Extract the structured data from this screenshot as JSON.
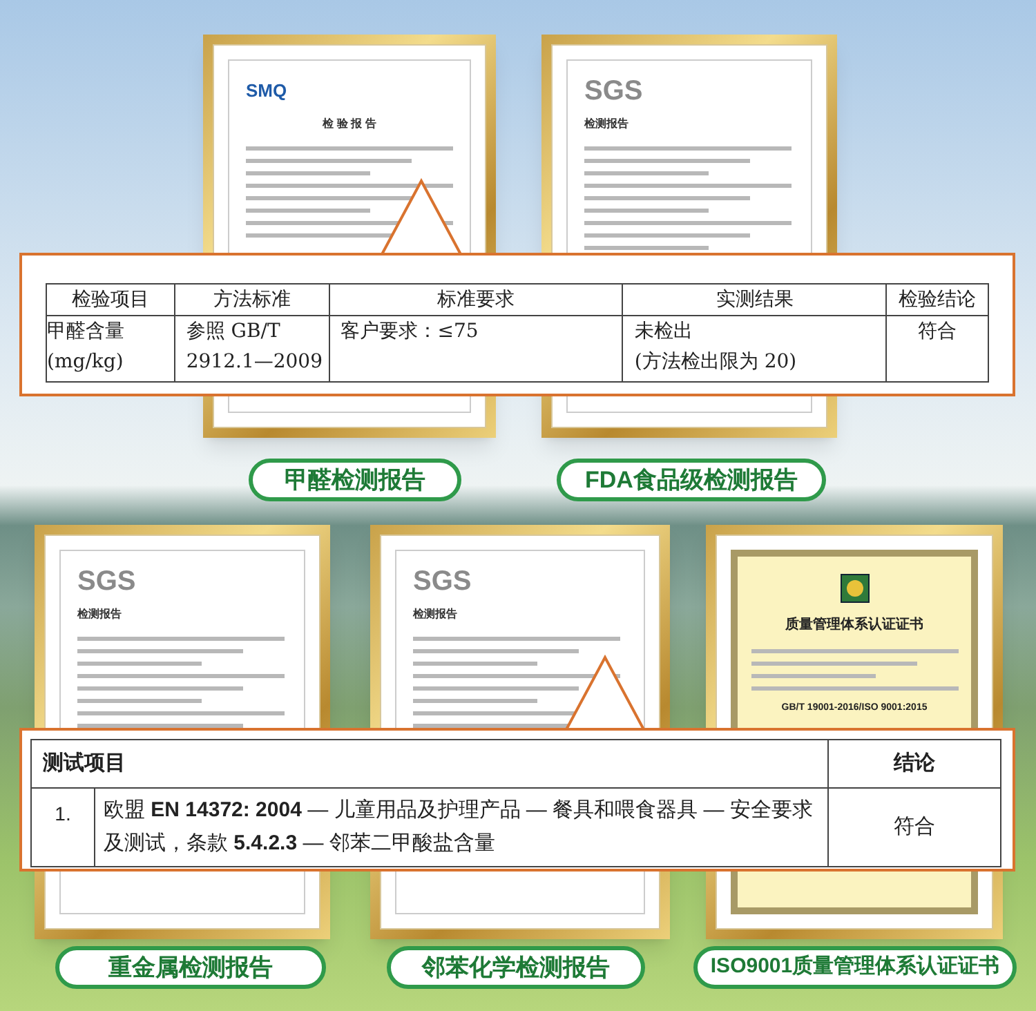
{
  "reports": [
    {
      "kind": "report",
      "logo": "SMQ",
      "title": "检 验 报 告",
      "label": "甲醛检测报告"
    },
    {
      "kind": "report",
      "logo": "SGS",
      "title": "检测报告",
      "label": "FDA食品级检测报告"
    },
    {
      "kind": "report",
      "logo": "SGS",
      "title": "检测报告",
      "label": "重金属检测报告"
    },
    {
      "kind": "report",
      "logo": "SGS",
      "title": "检测报告",
      "label": "邻苯化学检测报告"
    },
    {
      "kind": "certificate",
      "title": "质量管理体系认证证书",
      "standard": "GB/T 19001-2016/ISO 9001:2015",
      "label": "ISO9001质量管理体系认证证书"
    }
  ],
  "formaldehyde_table": {
    "columns": [
      "检验项目",
      "方法标准",
      "标准要求",
      "实测结果",
      "检验结论"
    ],
    "rows": [
      [
        [
          "甲醛含量",
          "(mg/kg)"
        ],
        [
          "参照 GB/T",
          "2912.1—2009"
        ],
        [
          "客户要求：≤75"
        ],
        [
          "未检出",
          "(方法检出限为 20)"
        ],
        [
          "符合"
        ]
      ]
    ]
  },
  "phthalate_table": {
    "columns": [
      "测试项目",
      "结论"
    ],
    "rows": [
      {
        "number": "1.",
        "item": "欧盟 **EN 14372: 2004** — 儿童用品及护理产品 — 餐具和喂食器具 — 安全要求及测试，条款 **5.4.2.3** — 邻苯二甲酸盐含量",
        "result": "符合"
      }
    ]
  }
}
